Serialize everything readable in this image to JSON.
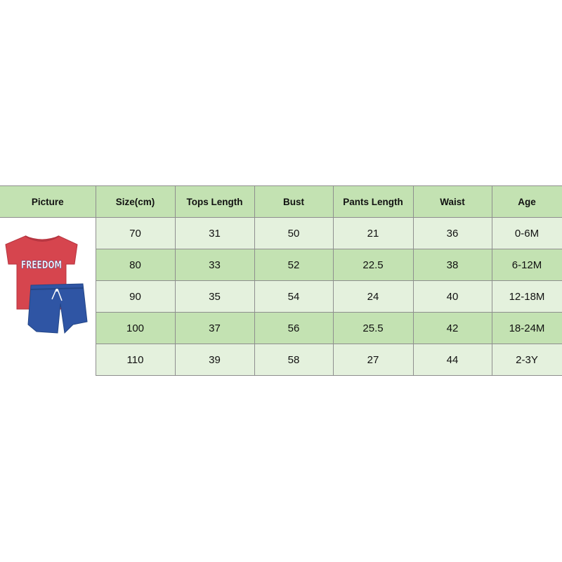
{
  "table": {
    "headers": [
      "Picture",
      "Size(cm)",
      "Tops Length",
      "Bust",
      "Pants Length",
      "Waist",
      "Age"
    ],
    "rows": [
      [
        "70",
        "31",
        "50",
        "21",
        "36",
        "0-6M"
      ],
      [
        "80",
        "33",
        "52",
        "22.5",
        "38",
        "6-12M"
      ],
      [
        "90",
        "35",
        "54",
        "24",
        "40",
        "12-18M"
      ],
      [
        "100",
        "37",
        "56",
        "25.5",
        "42",
        "18-24M"
      ],
      [
        "110",
        "39",
        "58",
        "27",
        "44",
        "2-3Y"
      ]
    ]
  },
  "product_image": {
    "shirt_print": "FREEDOM",
    "shirt_color": "#d6454e",
    "shorts_color": "#2f55a4"
  },
  "colors": {
    "header_bg": "#c3e2b2",
    "row_dark": "#c3e2b2",
    "row_light": "#e4f1dd"
  }
}
